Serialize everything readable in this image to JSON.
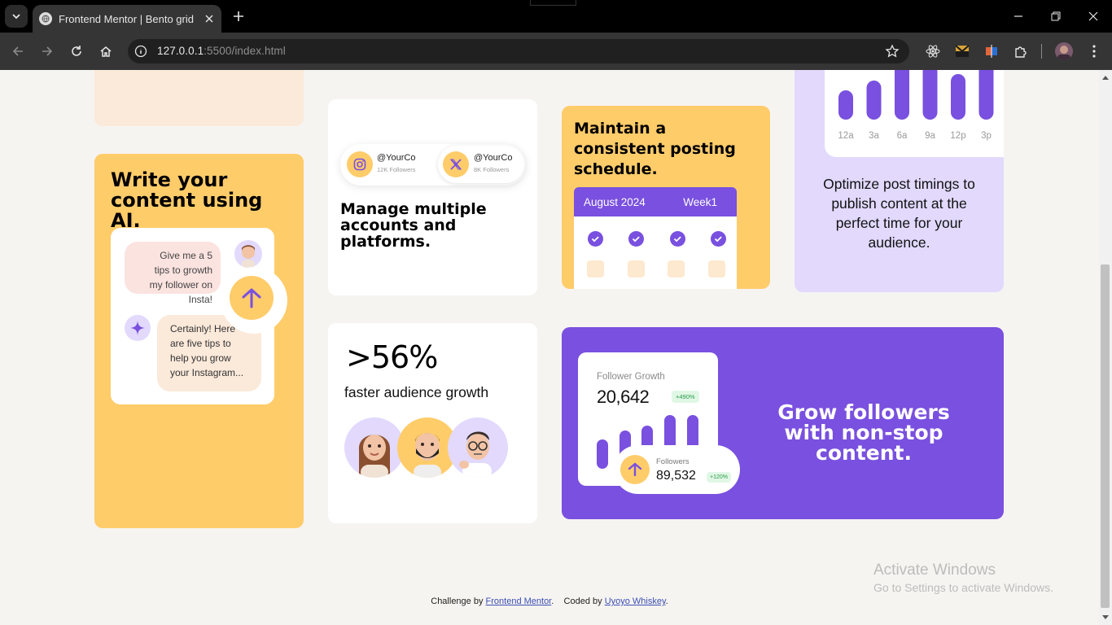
{
  "browser": {
    "tab_title": "Frontend Mentor | Bento grid",
    "url_host": "127.0.0.1",
    "url_rest": ":5500/index.html"
  },
  "cards": {
    "ai_content": {
      "title": "Write your content using AI.",
      "user_message": "Give me a 5 tips to growth my follower on Insta!",
      "ai_reply": "Certainly! Here are five tips to help you grow your Instagram..."
    },
    "accounts": {
      "title": "Manage multiple accounts and platforms.",
      "account_1_handle": "@YourCo",
      "account_1_followers": "12K Followers",
      "account_2_handle": "@YourCo",
      "account_2_followers": "8K Followers"
    },
    "schedule": {
      "title": "Maintain a consistent posting schedule.",
      "calendar_month": "August 2024",
      "calendar_week": "Week1"
    },
    "timings": {
      "time_labels": [
        "12a",
        "3a",
        "6a",
        "9a",
        "12p",
        "3p"
      ],
      "bar_levels": [
        0.45,
        0.6,
        0.95,
        0.85,
        0.7,
        0.9
      ],
      "text": "Optimize post timings to publish content at the perfect time for your audience."
    },
    "growth_stat": {
      "stat": ">56%",
      "label": "faster audience growth"
    },
    "followers": {
      "title": "Grow followers with non-stop content.",
      "panel_label": "Follower Growth",
      "panel_value": "20,642",
      "panel_change": "+490%",
      "followers_label": "Followers",
      "followers_value": "89,532",
      "followers_change": "+120%"
    }
  },
  "watermark": {
    "line1": "Activate Windows",
    "line2": "Go to Settings to activate Windows."
  },
  "footer": {
    "challenge_prefix": "Challenge by",
    "challenge_link": "Frontend Mentor",
    "coded_prefix": "Coded by",
    "coded_link": "Uyoyo Whiskey"
  },
  "colors": {
    "purple": "#7950df",
    "yellow": "#ffcc6a",
    "lavender": "#e2d9fd",
    "cream": "#fbe9da"
  }
}
